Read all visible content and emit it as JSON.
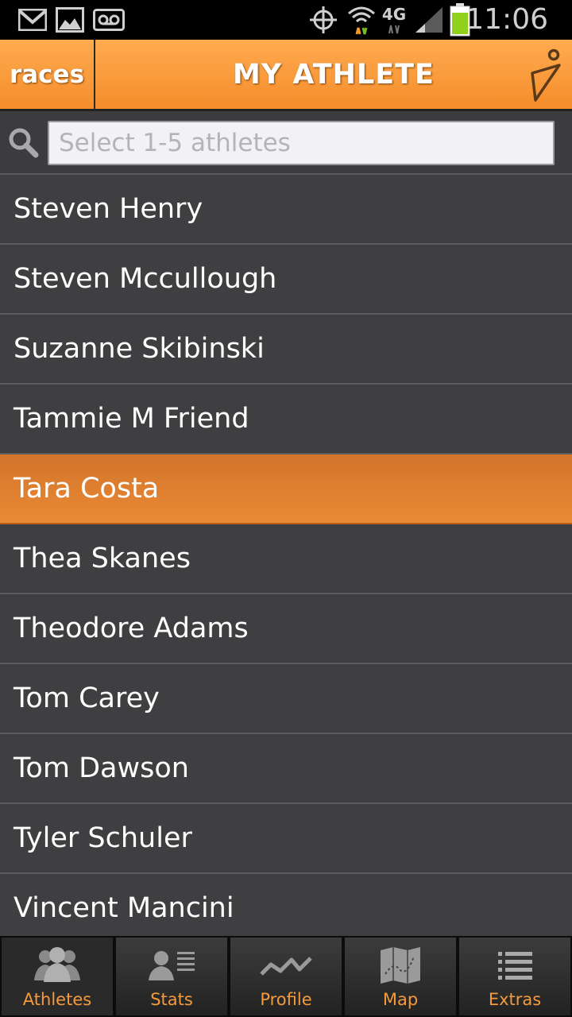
{
  "status_bar": {
    "time": "11:06",
    "icons": [
      "gmail-icon",
      "gallery-icon",
      "voicemail-icon",
      "gps-icon",
      "wifi-icon",
      "4g-lte-icon",
      "signal-icon",
      "battery-icon"
    ],
    "network_label": "4G"
  },
  "header": {
    "races_label": "races",
    "title": "MY ATHLETE",
    "logo_icon": "pin-logo-icon",
    "accent": "#f7962f"
  },
  "search": {
    "placeholder": "Select 1-5 athletes",
    "value": ""
  },
  "athletes": [
    {
      "name": "Steven Henry",
      "selected": false
    },
    {
      "name": "Steven Mccullough",
      "selected": false
    },
    {
      "name": "Suzanne Skibinski",
      "selected": false
    },
    {
      "name": "Tammie M Friend",
      "selected": false
    },
    {
      "name": "Tara Costa",
      "selected": true
    },
    {
      "name": "Thea Skanes",
      "selected": false
    },
    {
      "name": "Theodore Adams",
      "selected": false
    },
    {
      "name": "Tom Carey",
      "selected": false
    },
    {
      "name": "Tom Dawson",
      "selected": false
    },
    {
      "name": "Tyler Schuler",
      "selected": false
    },
    {
      "name": "Vincent Mancini",
      "selected": false
    }
  ],
  "nav": {
    "tabs": [
      {
        "label": "Athletes",
        "icon": "athletes-icon",
        "active": true
      },
      {
        "label": "Stats",
        "icon": "stats-icon",
        "active": false
      },
      {
        "label": "Profile",
        "icon": "profile-chart-icon",
        "active": false
      },
      {
        "label": "Map",
        "icon": "map-icon",
        "active": false
      },
      {
        "label": "Extras",
        "icon": "list-icon",
        "active": false
      }
    ]
  }
}
